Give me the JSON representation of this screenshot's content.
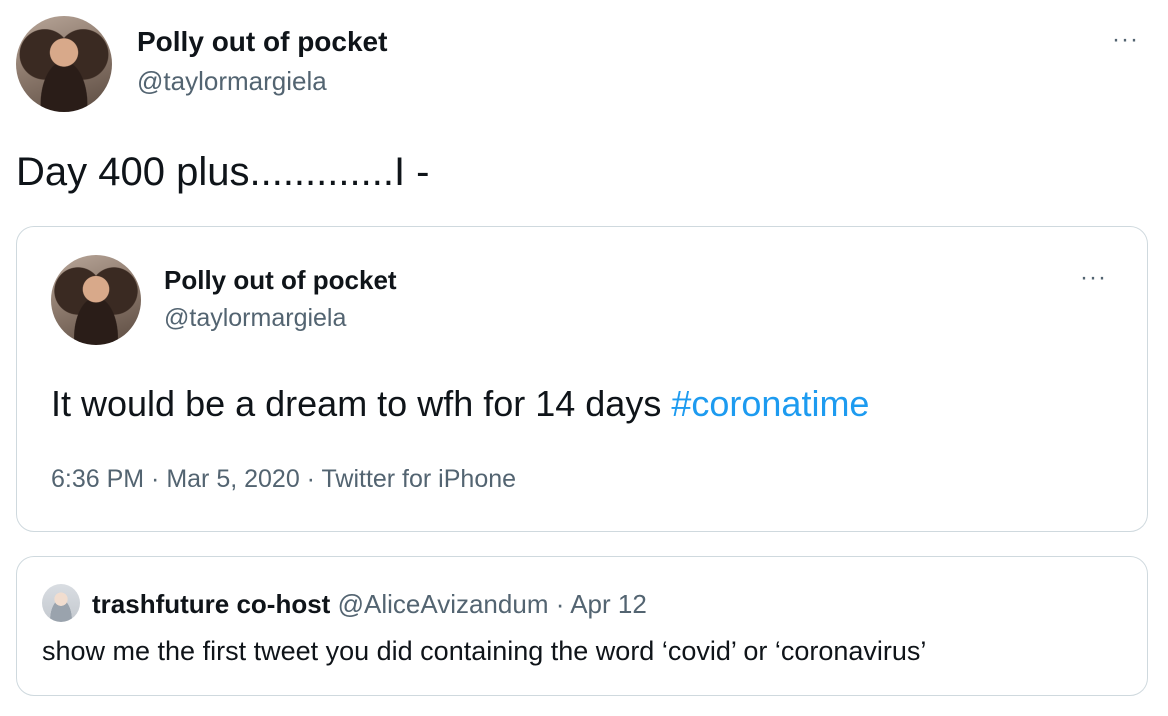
{
  "tweet": {
    "author_name": "Polly out of pocket",
    "author_handle": "@taylormargiela",
    "text": "Day 400 plus.............I -",
    "more_label": "···"
  },
  "quoted": {
    "author_name": "Polly out of pocket",
    "author_handle": "@taylormargiela",
    "text_main": "It would be a dream to wfh for 14 days ",
    "hashtag": "#coronatime",
    "timestamp": "6:36 PM · Mar 5, 2020 · Twitter for iPhone",
    "more_label": "···"
  },
  "reply_context": {
    "author_name": "trashfuture co-host",
    "author_handle": "@AliceAvizandum",
    "separator": "·",
    "date": "Apr 12",
    "text": "show me the first tweet you did containing the word ‘covid’ or ‘coronavirus’"
  },
  "colors": {
    "hashtag": "#1d9bf0",
    "secondary_text": "#536471",
    "border": "#cfd9de"
  }
}
